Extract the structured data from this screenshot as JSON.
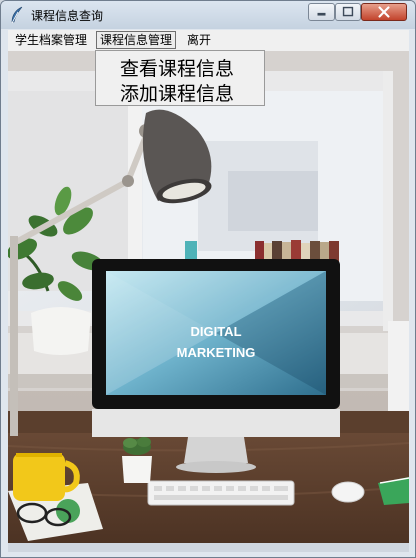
{
  "window": {
    "title": "课程信息查询"
  },
  "menubar": {
    "items": [
      {
        "label": "学生档案管理"
      },
      {
        "label": "课程信息管理"
      },
      {
        "label": "离开"
      }
    ]
  },
  "dropdown": {
    "items": [
      {
        "label": "查看课程信息"
      },
      {
        "label": "添加课程信息"
      }
    ]
  },
  "monitor_screen": {
    "line1": "DIGITAL",
    "line2": "MARKETING"
  },
  "colors": {
    "close_button": "#c2432c",
    "titlebar": "#c5d2e0",
    "menubar": "#f0f0f0"
  },
  "icons": {
    "app": "feather-icon",
    "minimize": "minimize-icon",
    "maximize": "maximize-icon",
    "close": "close-icon"
  }
}
